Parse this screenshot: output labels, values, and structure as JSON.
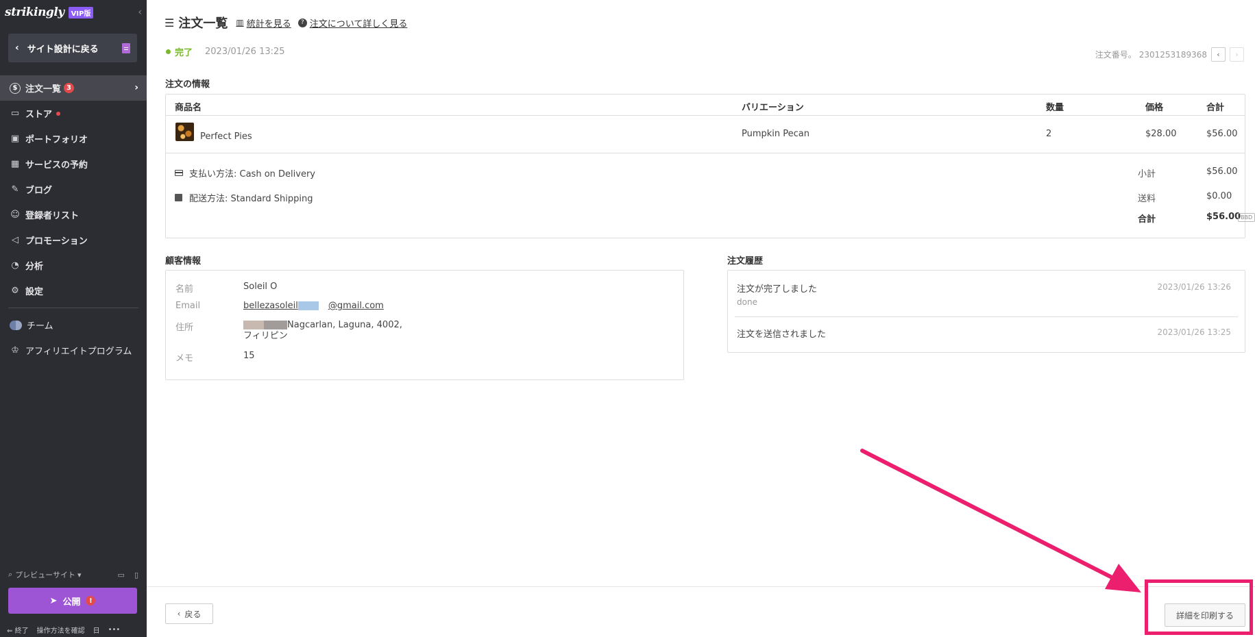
{
  "sidebar": {
    "logo": "strikingly",
    "vip": "VIP版",
    "back_label": "サイト設計に戻る",
    "items": [
      {
        "label": "注文一覧",
        "badge": "3"
      },
      {
        "label": "ストア"
      },
      {
        "label": "ポートフォリオ"
      },
      {
        "label": "サービスの予約"
      },
      {
        "label": "ブログ"
      },
      {
        "label": "登録者リスト"
      },
      {
        "label": "プロモーション"
      },
      {
        "label": "分析"
      },
      {
        "label": "設定"
      }
    ],
    "team_label": "チーム",
    "affiliate_label": "アフィリエイトプログラム",
    "preview_label": "プレビューサイト",
    "publish_label": "公開",
    "footer": {
      "exit": "終了",
      "help": "操作方法を確認",
      "lang": "日",
      "more": "•••"
    }
  },
  "header": {
    "title": "注文一覧",
    "stats_link": "統計を見る",
    "about_link": "注文について詳しく見る"
  },
  "status": {
    "label": "完了",
    "date": "2023/01/26 13:25",
    "order_number_label": "注文番号。",
    "order_number": "2301253189368"
  },
  "order_info": {
    "title": "注文の情報",
    "columns": {
      "product": "商品名",
      "variation": "バリエーション",
      "qty": "数量",
      "price": "価格",
      "total": "合計"
    },
    "items": [
      {
        "product": "Perfect Pies",
        "variation": "Pumpkin Pecan",
        "qty": "2",
        "price": "$28.00",
        "total": "$56.00"
      }
    ],
    "payment": "支払い方法: Cash on Delivery",
    "shipping": "配送方法: Standard Shipping",
    "subtotal_label": "小計",
    "subtotal": "$56.00",
    "shipping_fee_label": "送料",
    "shipping_fee": "$0.00",
    "total_label": "合計",
    "total": "$56.00",
    "currency": "BBD"
  },
  "customer": {
    "title": "顧客情報",
    "name_label": "名前",
    "name": "Soleil O",
    "email_label": "Email",
    "email_prefix": "bellezasoleil",
    "email_suffix": "@gmail.com",
    "address_label": "住所",
    "address_line1": "Nagcarlan, Laguna, 4002,",
    "address_line2": "フィリピン",
    "memo_label": "メモ",
    "memo": "15"
  },
  "history": {
    "title": "注文履歴",
    "entries": [
      {
        "title": "注文が完了しました",
        "sub": "done",
        "date": "2023/01/26 13:26"
      },
      {
        "title": "注文を送信されました",
        "date": "2023/01/26 13:25"
      }
    ]
  },
  "footer": {
    "back_label": "戻る",
    "print_label": "詳細を印刷する"
  },
  "colors": {
    "accent": "#9d55d6",
    "highlight": "#ec1f6f",
    "success": "#79b82b"
  }
}
